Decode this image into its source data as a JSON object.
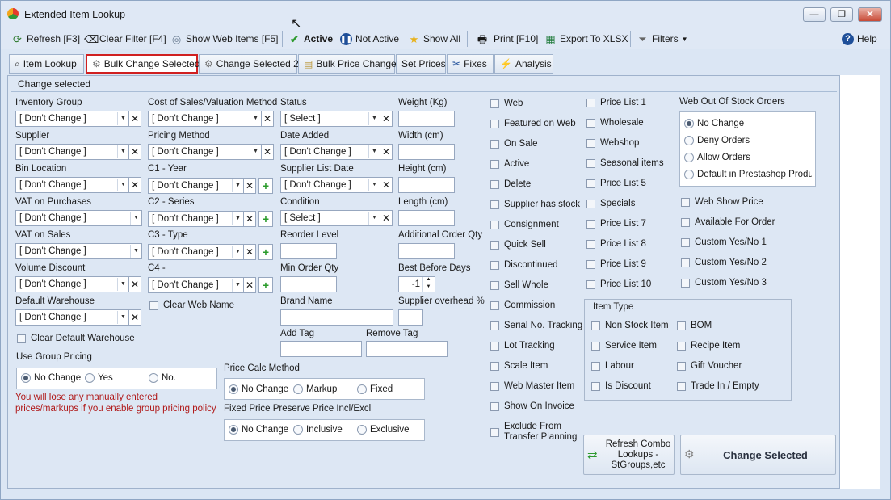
{
  "window": {
    "title": "Extended Item Lookup",
    "minimize": "—",
    "maximize": "❐",
    "close": "✕"
  },
  "toolbar": {
    "refresh": "Refresh [F3]",
    "clear_filter": "Clear Filter [F4]",
    "show_web_items": "Show Web Items [F5]",
    "active": "Active",
    "not_active": "Not Active",
    "show_all": "Show All",
    "print": "Print [F10]",
    "export": "Export To XLSX",
    "filters": "Filters",
    "help": "Help"
  },
  "tabs": [
    "Item Lookup",
    "Bulk Change Selected",
    "Change Selected 2",
    "Bulk Price Change",
    "Set Prices",
    "Fixes",
    "Analysis"
  ],
  "panel_title": "Change selected",
  "fields": {
    "inventory_group": {
      "label": "Inventory Group",
      "value": "[ Don't Change ]"
    },
    "supplier": {
      "label": "Supplier",
      "value": "[ Don't Change ]"
    },
    "bin_location": {
      "label": "Bin Location",
      "value": "[ Don't Change ]"
    },
    "vat_purchases": {
      "label": "VAT on Purchases",
      "value": "[ Don't Change ]"
    },
    "vat_sales": {
      "label": "VAT on Sales",
      "value": "[ Don't Change ]"
    },
    "volume_discount": {
      "label": "Volume Discount",
      "value": "[ Don't Change ]"
    },
    "default_warehouse": {
      "label": "Default Warehouse",
      "value": "[ Don't Change ]"
    },
    "cost_of_sales": {
      "label": "Cost of Sales/Valuation Method",
      "value": "[ Don't Change ]"
    },
    "pricing_method": {
      "label": "Pricing Method",
      "value": "[ Don't Change ]"
    },
    "c1": {
      "label": "C1 - Year",
      "value": "[ Don't Change ]"
    },
    "c2": {
      "label": "C2 - Series",
      "value": "[ Don't Change ]"
    },
    "c3": {
      "label": "C3 -  Type",
      "value": "[ Don't Change ]"
    },
    "c4": {
      "label": "C4 -",
      "value": "[ Don't Change ]"
    },
    "status": {
      "label": "Status",
      "value": "[ Select ]"
    },
    "date_added": {
      "label": "Date Added",
      "value": "[ Don't Change ]"
    },
    "supplier_list_date": {
      "label": "Supplier List Date",
      "value": "[ Don't Change ]"
    },
    "condition": {
      "label": "Condition",
      "value": "[ Select ]"
    },
    "reorder_level": {
      "label": "Reorder Level"
    },
    "min_order_qty": {
      "label": "Min Order Qty"
    },
    "brand_name": {
      "label": "Brand Name"
    },
    "add_tag": {
      "label": "Add Tag"
    },
    "remove_tag": {
      "label": "Remove Tag"
    },
    "weight": {
      "label": "Weight (Kg)"
    },
    "width": {
      "label": "Width (cm)"
    },
    "height": {
      "label": "Height (cm)"
    },
    "length": {
      "label": "Length (cm)"
    },
    "additional_order_qty": {
      "label": "Additional Order Qty"
    },
    "best_before_days": {
      "label": "Best Before Days",
      "value": "-1"
    },
    "supplier_overhead": {
      "label": "Supplier overhead %"
    }
  },
  "clear_web_name": "Clear Web Name",
  "clear_default_warehouse": "Clear Default Warehouse",
  "use_group_pricing": {
    "label": "Use Group Pricing",
    "options": [
      "No Change",
      "Yes",
      "No."
    ],
    "selected": "No Change"
  },
  "warning": "You will lose any manually entered prices/markups if you enable group pricing policy",
  "price_calc_method": {
    "label": "Price Calc Method",
    "options": [
      "No Change",
      "Markup",
      "Fixed"
    ],
    "selected": "No Change"
  },
  "fixed_price_preserve": {
    "label": "Fixed Price Preserve Price Incl/Excl",
    "options": [
      "No Change",
      "Inclusive",
      "Exclusive"
    ],
    "selected": "No Change"
  },
  "checks_col1": [
    "Web",
    "Featured on Web",
    "On Sale",
    "Active",
    "Delete",
    "Supplier has stock",
    "Consignment",
    "Quick Sell",
    "Discontinued",
    "Sell Whole",
    "Commission",
    "Serial No. Tracking",
    "Lot Tracking",
    "Scale Item",
    "Web Master Item",
    "Show On Invoice",
    "Exclude From Transfer Planning"
  ],
  "checks_col2": [
    "Price List 1",
    "Wholesale",
    "Webshop",
    "Seasonal items",
    "Price List 5",
    "Specials",
    "Price List 7",
    "Price List 8",
    "Price List 9",
    "Price List 10"
  ],
  "web_out_of_stock": {
    "label": "Web Out Of Stock Orders",
    "options": [
      "No Change",
      "Deny Orders",
      "Allow Orders",
      "Default in Prestashop Product"
    ],
    "selected": "No Change"
  },
  "checks_col3": [
    "Web Show Price",
    "Available For Order",
    "Custom Yes/No 1",
    "Custom Yes/No 2",
    "Custom Yes/No 3"
  ],
  "item_type": {
    "label": "Item Type",
    "col1": [
      "Non Stock Item",
      "Service Item",
      "Labour",
      "Is Discount"
    ],
    "col2": [
      "BOM",
      "Recipe Item",
      "Gift Voucher",
      "Trade In / Empty"
    ]
  },
  "refresh_combo": "Refresh Combo Lookups - StGroups,etc",
  "change_selected": "Change Selected",
  "colors": {
    "accent": "#2b6fd6",
    "active_tab_border": "#d02020",
    "warning": "#b01818",
    "window_bg": "#dbe6f4"
  }
}
